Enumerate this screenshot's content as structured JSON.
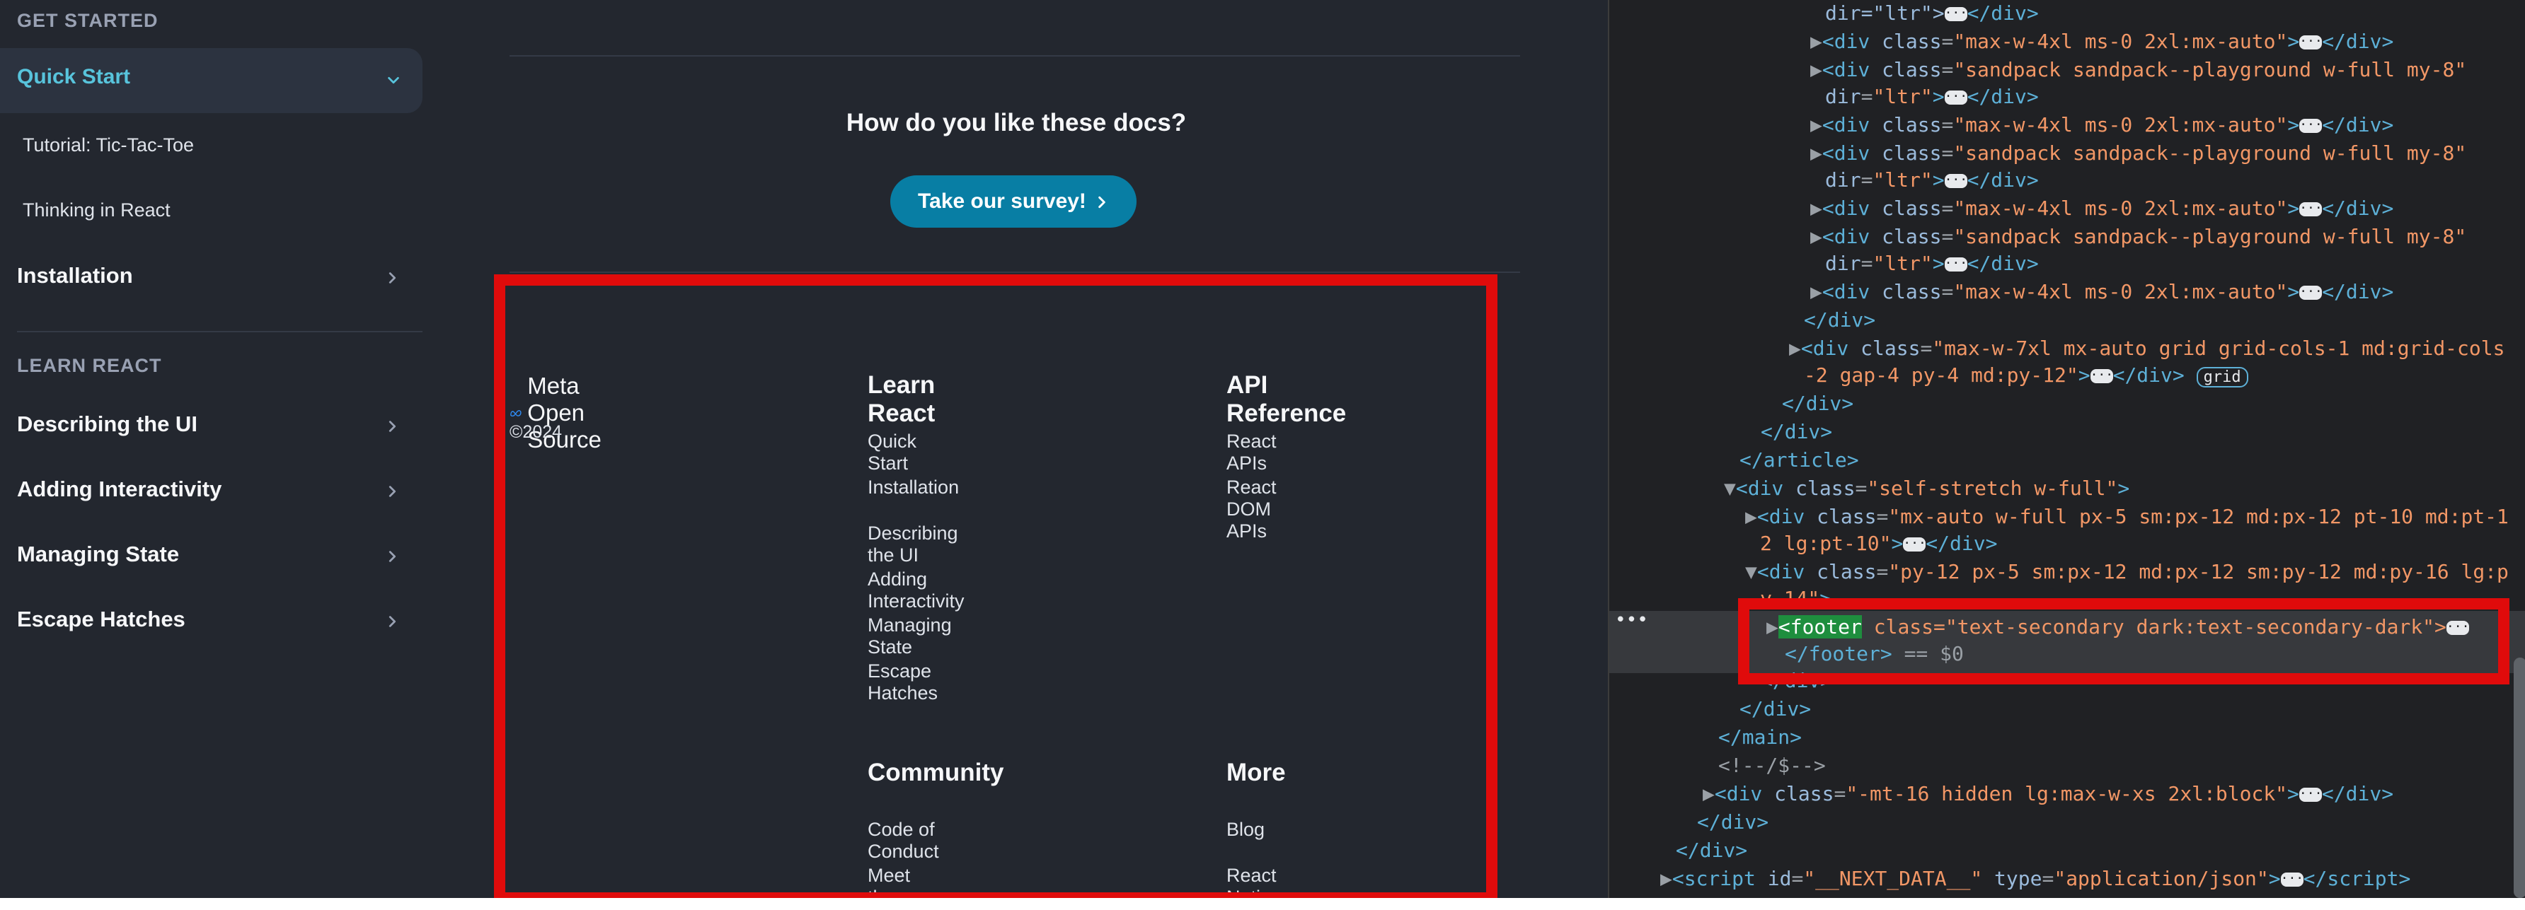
{
  "sidebar": {
    "get_started_heading": "GET STARTED",
    "active_item": "Quick Start",
    "sub_items": [
      "Tutorial: Tic-Tac-Toe",
      "Thinking in React"
    ],
    "installation": "Installation",
    "learn_react_heading": "LEARN REACT",
    "learn_items": [
      "Describing the UI",
      "Adding Interactivity",
      "Managing State",
      "Escape Hatches"
    ]
  },
  "main": {
    "feedback_question": "How do you like these docs?",
    "survey_button": "Take our survey!"
  },
  "footer": {
    "logo_text": "Meta Open Source",
    "copyright": "©2024",
    "columns": [
      {
        "title": "Learn React",
        "links": [
          "Quick Start",
          "Installation",
          "Describing the UI",
          "Adding Interactivity",
          "Managing State",
          "Escape Hatches"
        ]
      },
      {
        "title": "API Reference",
        "links": [
          "React APIs",
          "React DOM APIs"
        ]
      },
      {
        "title": "Community",
        "links": [
          "Code of Conduct",
          "Meet the Team"
        ]
      },
      {
        "title": "More",
        "links": [
          "Blog",
          "React Native"
        ]
      }
    ]
  },
  "devtools": {
    "lines": [
      "dir=\"ltr\">",
      "<div class=\"max-w-4xl ms-0 2xl:mx-auto\">",
      "<div class=\"sandpack sandpack--playground w-full my-8\"",
      "<div class=\"self-stretch w-full\">",
      "<footer class=\"text-secondary dark:text-secondary-dark\">",
      "</footer> == $0"
    ],
    "selected_tag": "<footer",
    "selected_attr": "class=\"text-secondary dark:text-secondary-dark\">",
    "selected_close": "</footer>",
    "selected_ref": "== $0",
    "grid_badge": "grid",
    "next_data_id": "__NEXT_DATA__",
    "next_data_type": "application/json"
  },
  "colors": {
    "highlight": "#e00b0b",
    "accent": "#58c4dc",
    "button": "#087ea4"
  }
}
